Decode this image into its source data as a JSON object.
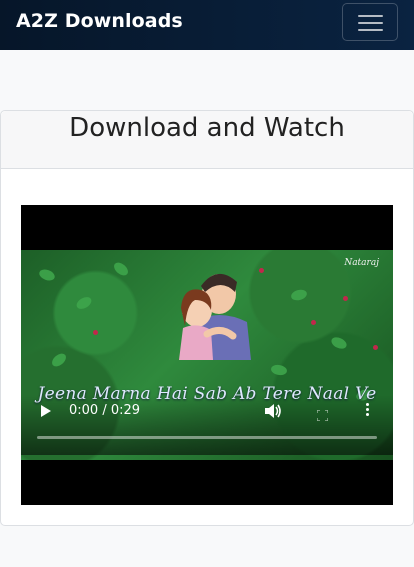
{
  "navbar": {
    "brand": "A2Z Downloads",
    "menu_icon": "hamburger-icon"
  },
  "card": {
    "title": "Download and Watch"
  },
  "video": {
    "caption": "Jeena Marna Hai Sab Ab Tere Naal Ve",
    "watermark": "Nataraj",
    "time": "0:00 / 0:29",
    "progress": 0.0,
    "icons": {
      "play": "play-icon",
      "volume": "volume-icon",
      "fullscreen": "fullscreen-icon",
      "more": "more-options-icon"
    }
  }
}
